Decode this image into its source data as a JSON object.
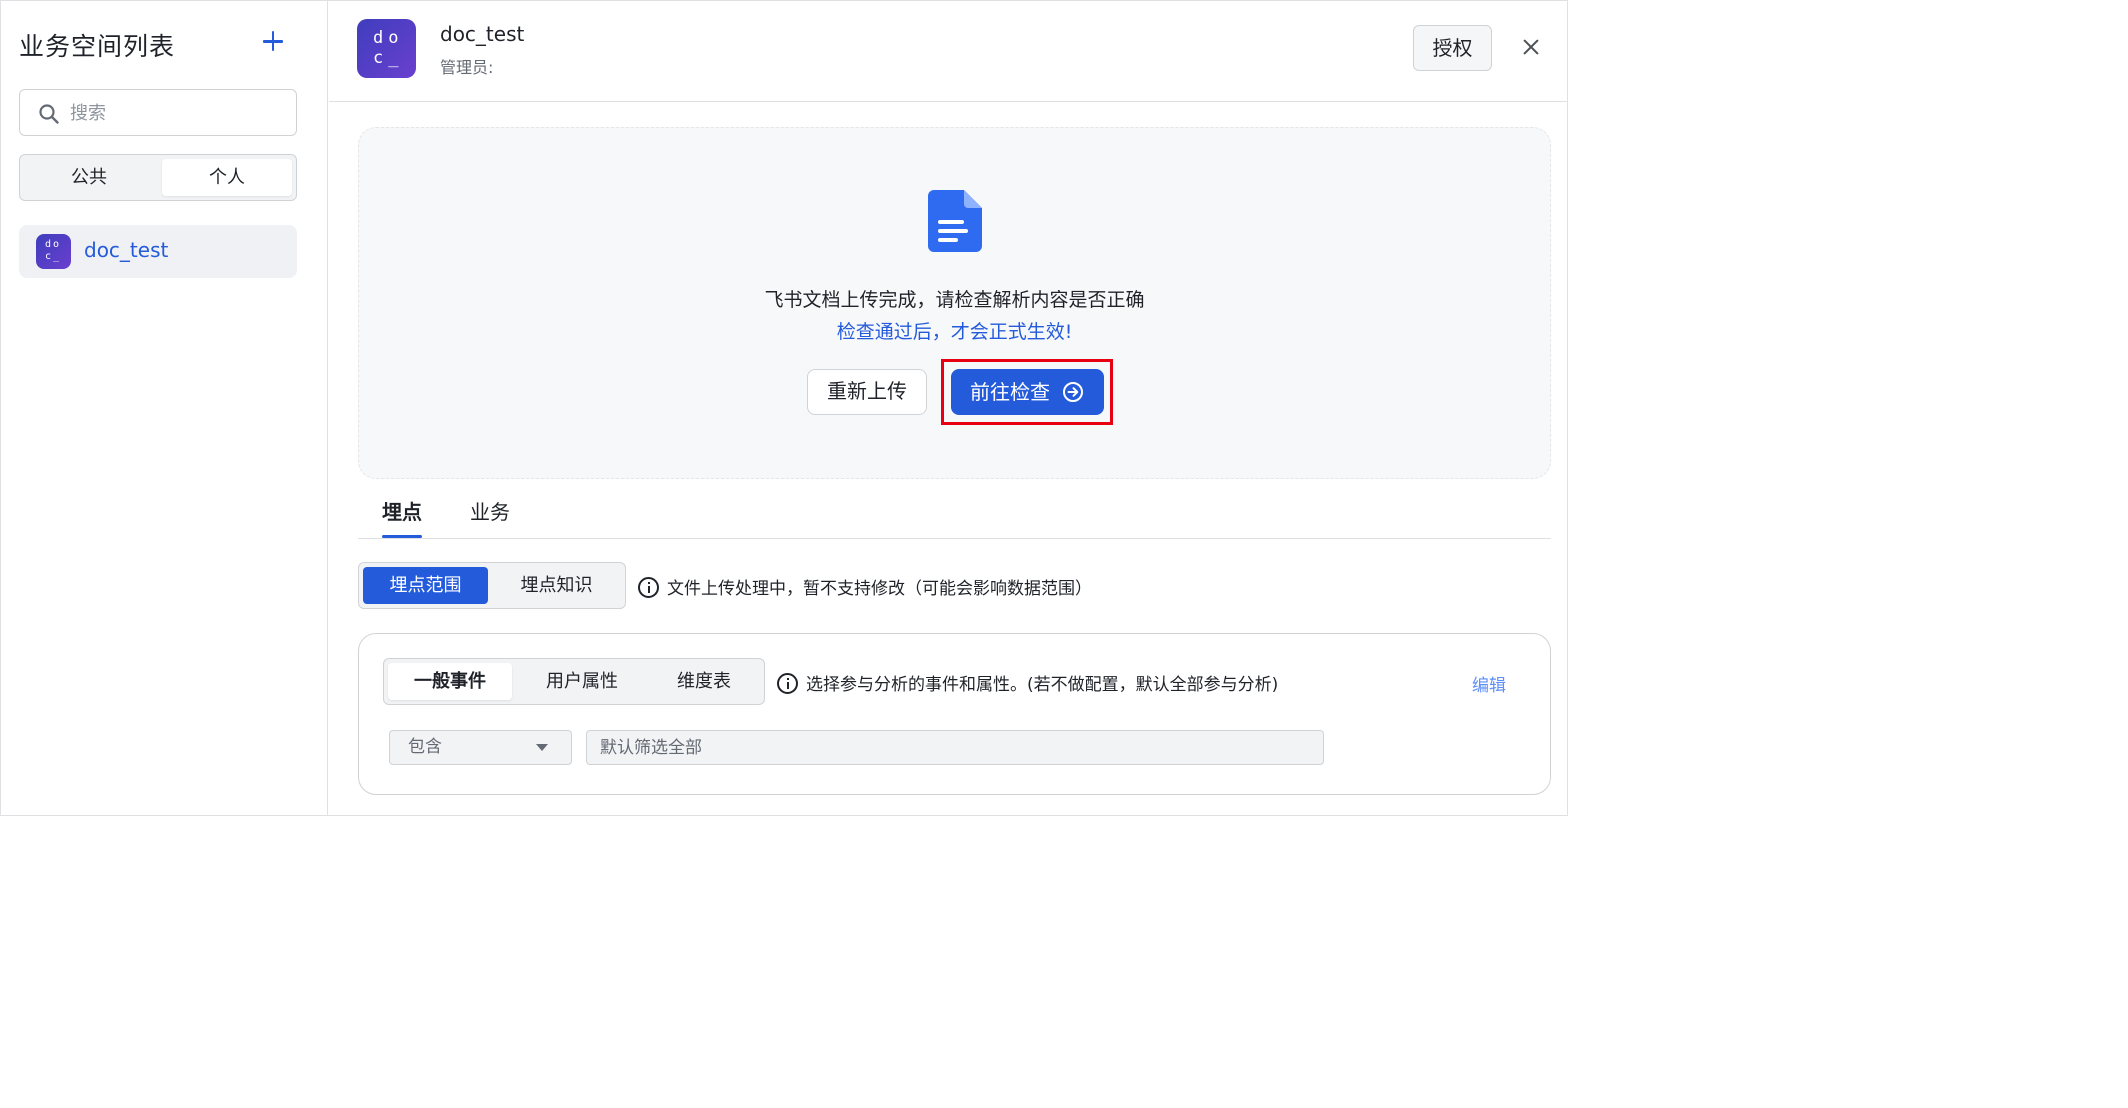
{
  "sidebar": {
    "title": "业务空间列表",
    "add_icon": "plus-icon",
    "search_placeholder": "搜索",
    "scope_tabs": [
      "公共",
      "个人"
    ],
    "selected_scope": "个人",
    "workspaces": [
      {
        "avatar_text": "do c_",
        "label": "doc_test"
      }
    ]
  },
  "header": {
    "avatar_text": "do c_",
    "title": "doc_test",
    "subtitle": "管理员:",
    "auth_button": "授权",
    "close_icon": "close-icon"
  },
  "upload": {
    "icon": "document-icon",
    "message": "飞书文档上传完成，请检查解析内容是否正确",
    "hint": "检查通过后，才会正式生效!",
    "reupload_button": "重新上传",
    "check_button": "前往检查",
    "check_icon": "arrow-right-circle-icon"
  },
  "tabs": {
    "items": [
      "埋点",
      "业务"
    ],
    "active": "埋点"
  },
  "subtabs": {
    "items": [
      "埋点范围",
      "埋点知识"
    ],
    "active": "埋点范围",
    "info": "文件上传处理中，暂不支持修改（可能会影响数据范围）"
  },
  "card": {
    "segments": [
      "一般事件",
      "用户属性",
      "维度表"
    ],
    "active_segment": "一般事件",
    "info": "选择参与分析的事件和属性。(若不做配置，默认全部参与分析)",
    "edit_label": "编辑",
    "select_value": "包含",
    "filter_placeholder": "默认筛选全部"
  },
  "colors": {
    "primary": "#245bdb",
    "highlight": "#e60012",
    "avatar_gradient": [
      "#3f3ebd",
      "#6a3fcf"
    ]
  }
}
